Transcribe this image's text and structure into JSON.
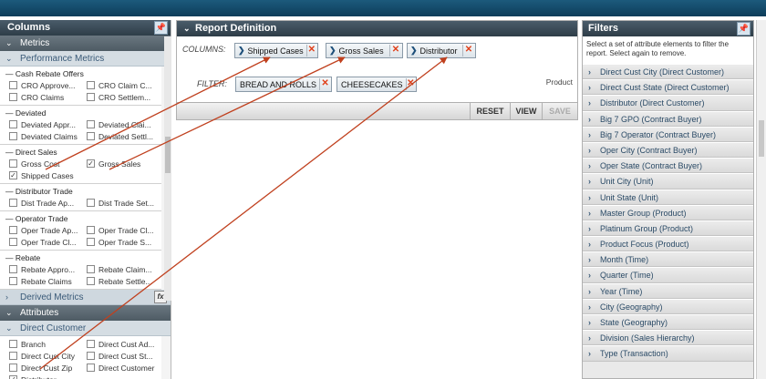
{
  "colors": {
    "topbar": "#1c5a7c",
    "arrow": "#c0401e",
    "remove": "#e0401a"
  },
  "columns_panel": {
    "title": "Columns",
    "pin_icon": "pin-icon",
    "metrics_label": "Metrics",
    "performance_label": "Performance Metrics",
    "groups": [
      {
        "name": "Cash Rebate Offers",
        "rows": [
          [
            "CRO Approve...",
            "CRO Claim C..."
          ],
          [
            "CRO Claims",
            "CRO Settlem..."
          ]
        ],
        "checked": []
      },
      {
        "name": "Deviated",
        "rows": [
          [
            "Deviated Appr...",
            "Deviated Clai..."
          ],
          [
            "Deviated Claims",
            "Deviated Settl..."
          ]
        ],
        "checked": []
      },
      {
        "name": "Direct Sales",
        "rows": [
          [
            "Gross Cost",
            "Gross Sales"
          ],
          [
            "Shipped Cases",
            ""
          ]
        ],
        "checked": [
          "Gross Sales",
          "Shipped Cases"
        ]
      },
      {
        "name": "Distributor Trade",
        "rows": [
          [
            "Dist Trade Ap...",
            "Dist Trade Set..."
          ]
        ],
        "checked": []
      },
      {
        "name": "Operator Trade",
        "rows": [
          [
            "Oper Trade Ap...",
            "Oper Trade Cl..."
          ],
          [
            "Oper Trade Cl...",
            "Oper Trade S..."
          ]
        ],
        "checked": []
      },
      {
        "name": "Rebate",
        "rows": [
          [
            "Rebate Appro...",
            "Rebate Claim..."
          ],
          [
            "Rebate Claims",
            "Rebate Settle..."
          ]
        ],
        "checked": []
      }
    ],
    "derived_label": "Derived Metrics",
    "fx_label": "fx",
    "attributes_label": "Attributes",
    "direct_customer_label": "Direct Customer",
    "direct_customer_rows": [
      [
        "Branch",
        "Direct Cust Ad..."
      ],
      [
        "Direct Cust City",
        "Direct Cust St..."
      ],
      [
        "Direct Cust Zip",
        "Direct Customer"
      ],
      [
        "Distributor",
        ""
      ]
    ],
    "direct_customer_checked": [
      "Distributor"
    ]
  },
  "report": {
    "title": "Report Definition",
    "columns_label": "COLUMNS:",
    "column_chips": [
      "Shipped Cases",
      "Gross Sales",
      "Distributor"
    ],
    "filter_label": "FILTER:",
    "filter_chips": [
      "BREAD AND ROLLS",
      "CHEESECAKES"
    ],
    "product_label": "Product",
    "buttons": {
      "reset": "RESET",
      "view": "VIEW",
      "save": "SAVE"
    }
  },
  "filters": {
    "title": "Filters",
    "description": "Select a set of attribute elements to filter the report. Select again to remove.",
    "items": [
      "Direct Cust City (Direct Customer)",
      "Direct Cust State (Direct Customer)",
      "Distributor (Direct Customer)",
      "Big 7 GPO (Contract Buyer)",
      "Big 7 Operator (Contract Buyer)",
      "Oper City (Contract Buyer)",
      "Oper State (Contract Buyer)",
      "Unit City (Unit)",
      "Unit State (Unit)",
      "Master Group (Product)",
      "Platinum Group (Product)",
      "Product Focus (Product)",
      "Month (Time)",
      "Quarter (Time)",
      "Year (Time)",
      "City (Geography)",
      "State (Geography)",
      "Division (Sales Hierarchy)",
      "Type (Transaction)"
    ]
  }
}
